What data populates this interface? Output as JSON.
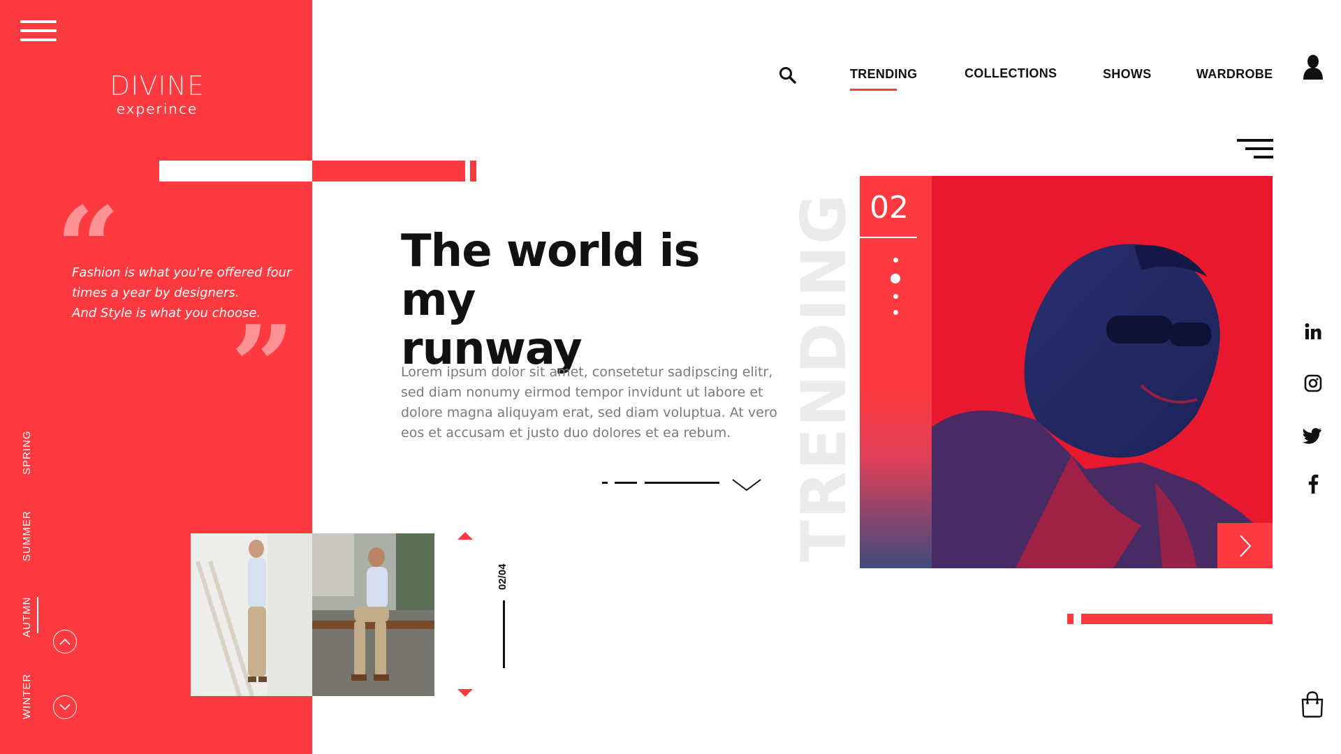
{
  "brand": {
    "name": "DIVINE",
    "tagline": "experince"
  },
  "quote": {
    "open_mark": "“",
    "close_mark": "”",
    "line1": "Fashion is what you're offered four",
    "line2": "times a year by designers.",
    "line3": "And Style is what you choose."
  },
  "seasons": [
    "SPRING",
    "SUMMER",
    "AUTMN",
    "WINTER"
  ],
  "active_season": "AUTMN",
  "slider": {
    "progress": 0.5,
    "counter": "02/04"
  },
  "hero": {
    "title_line1": "The world is my",
    "title_line2": "runway",
    "body": "Lorem ipsum dolor sit amet, consetetur sadipscing elitr, sed diam nonumy eirmod tempor invidunt ut labore et dolore magna aliquyam erat, sed diam voluptua. At vero eos et accusam et justo duo dolores et ea rebum."
  },
  "nav": {
    "items": [
      "TRENDING",
      "COLLECTIONS",
      "SHOWS",
      "WARDROBE"
    ],
    "active": "TRENDING"
  },
  "feature": {
    "vertical_label": "TRENDING",
    "number": "02",
    "dots": 4,
    "active_dot": 2
  },
  "icons": {
    "menu": "hamburger-icon",
    "search": "search-icon",
    "user": "user-icon",
    "filter": "menu-lines-icon",
    "linkedin": "linkedin-icon",
    "instagram": "instagram-icon",
    "twitter": "twitter-icon",
    "facebook": "facebook-icon",
    "bag": "shopping-bag-icon",
    "next": "chevron-right-icon",
    "up": "chevron-up-icon",
    "down": "chevron-down-icon"
  },
  "colors": {
    "accent": "#fd3a3f",
    "text": "#111111",
    "muted": "#7a7a7a"
  }
}
